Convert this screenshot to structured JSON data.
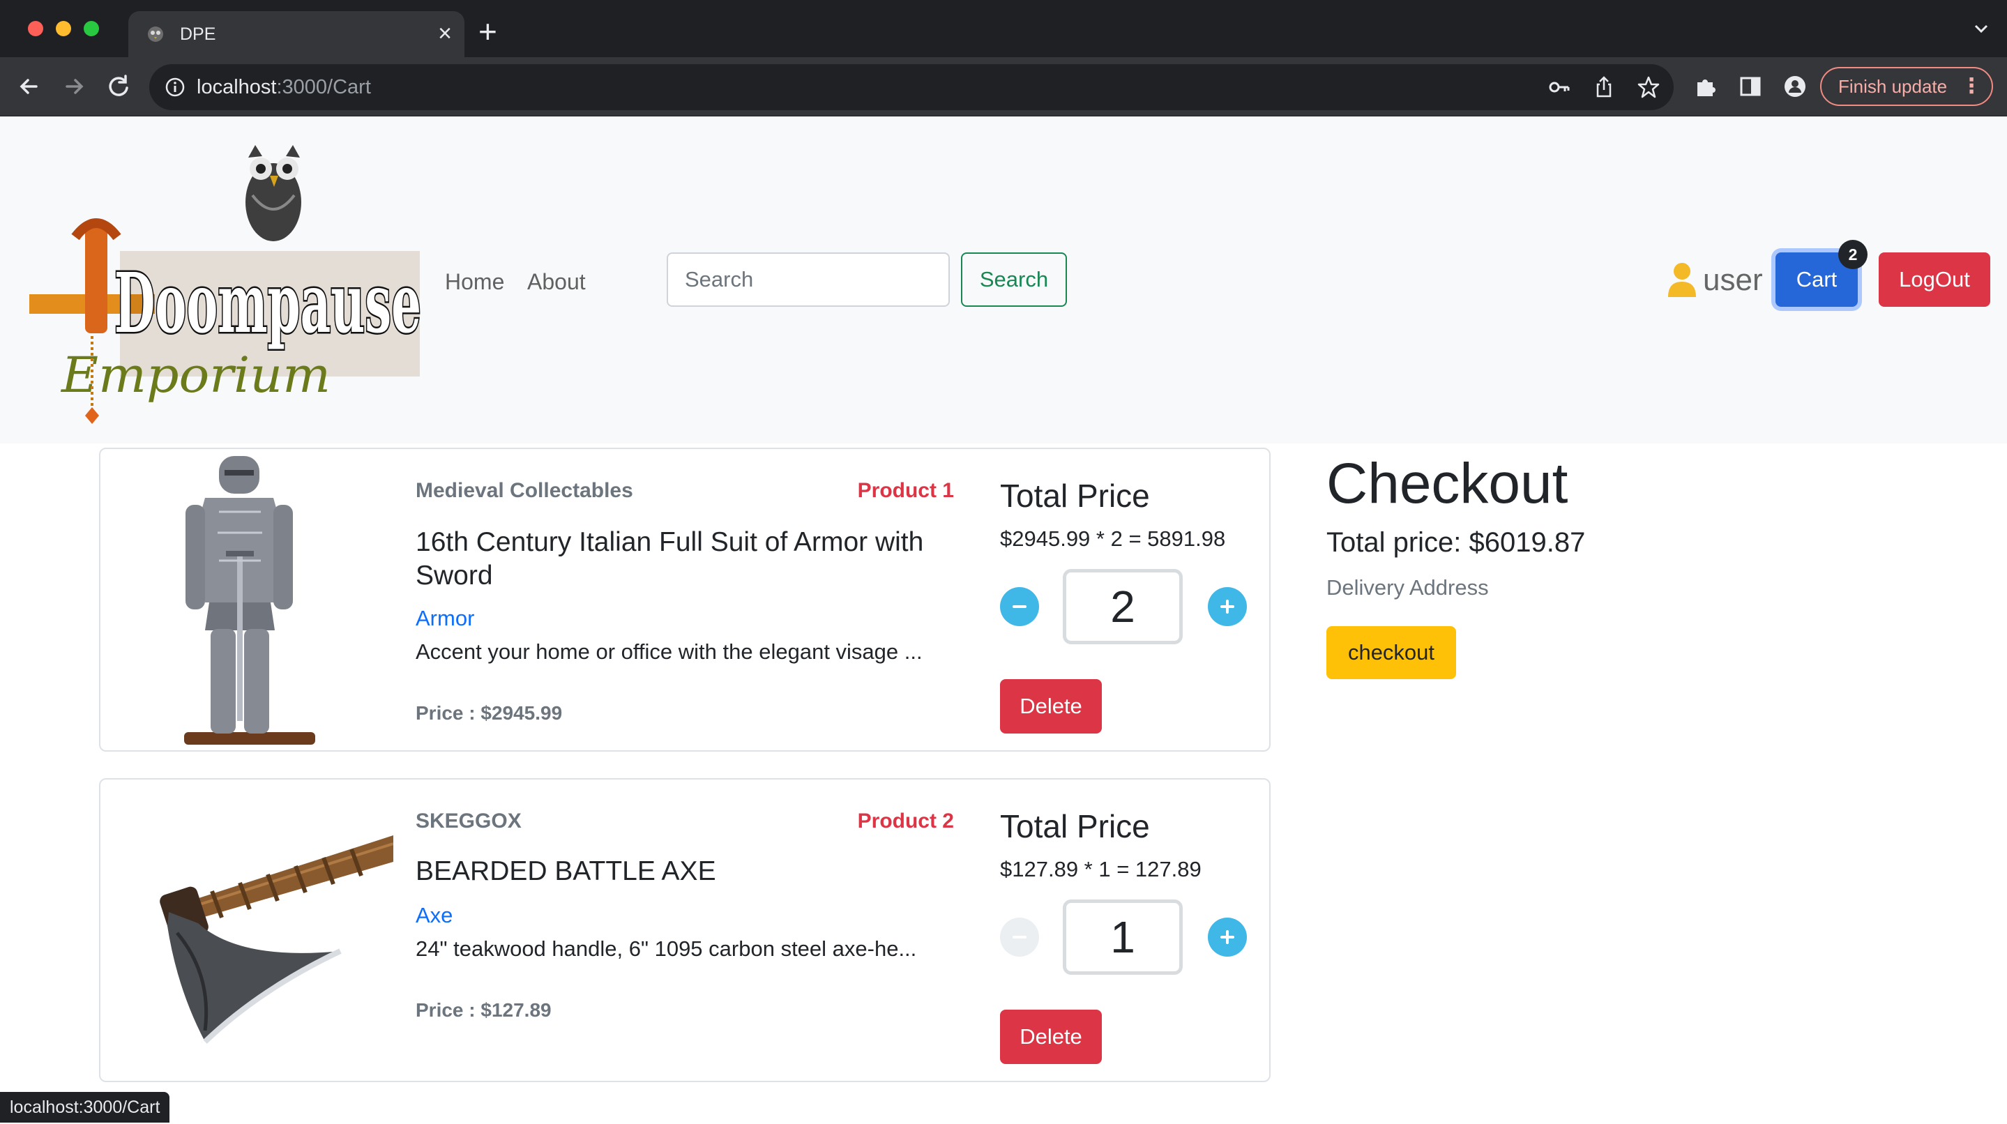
{
  "browser": {
    "tab_title": "DPE",
    "tab_close": "×",
    "new_tab": "+",
    "url_host": "localhost",
    "url_path": ":3000/Cart",
    "finish_update": "Finish update",
    "status_url": "localhost:3000/Cart"
  },
  "navbar": {
    "links": [
      "Home",
      "About"
    ],
    "search_placeholder": "Search",
    "search_button": "Search",
    "user": "user",
    "cart": "Cart",
    "cart_count": "2",
    "logout": "LogOut"
  },
  "cart_items": [
    {
      "brand": "Medieval Collectables",
      "product_no": "Product 1",
      "name": "16th Century Italian Full Suit of Armor with Sword",
      "category": "Armor",
      "description": "Accent your home or office with the elegant visage ...",
      "price": "Price : $2945.99",
      "total_title": "Total Price",
      "total_calc": "$2945.99 * 2 = 5891.98",
      "quantity": "2",
      "delete": "Delete",
      "image": "armor-suit"
    },
    {
      "brand": "SKEGGOX",
      "product_no": "Product 2",
      "name": "BEARDED BATTLE AXE",
      "category": "Axe",
      "description": "24\" teakwood handle, 6\" 1095 carbon steel axe-he...",
      "price": "Price : $127.89",
      "total_title": "Total Price",
      "total_calc": "$127.89 * 1 = 127.89",
      "quantity": "1",
      "delete": "Delete",
      "image": "bearded-axe"
    }
  ],
  "checkout": {
    "title": "Checkout",
    "total": "Total price: $6019.87",
    "delivery": "Delivery Address",
    "button": "checkout"
  },
  "logo": {
    "line1": "Doompause",
    "line2": "Emporium"
  },
  "colors": {
    "primary": "#2566d9",
    "danger": "#dc3545",
    "success": "#198754",
    "warning": "#ffc107",
    "info": "#3fb8e8"
  }
}
